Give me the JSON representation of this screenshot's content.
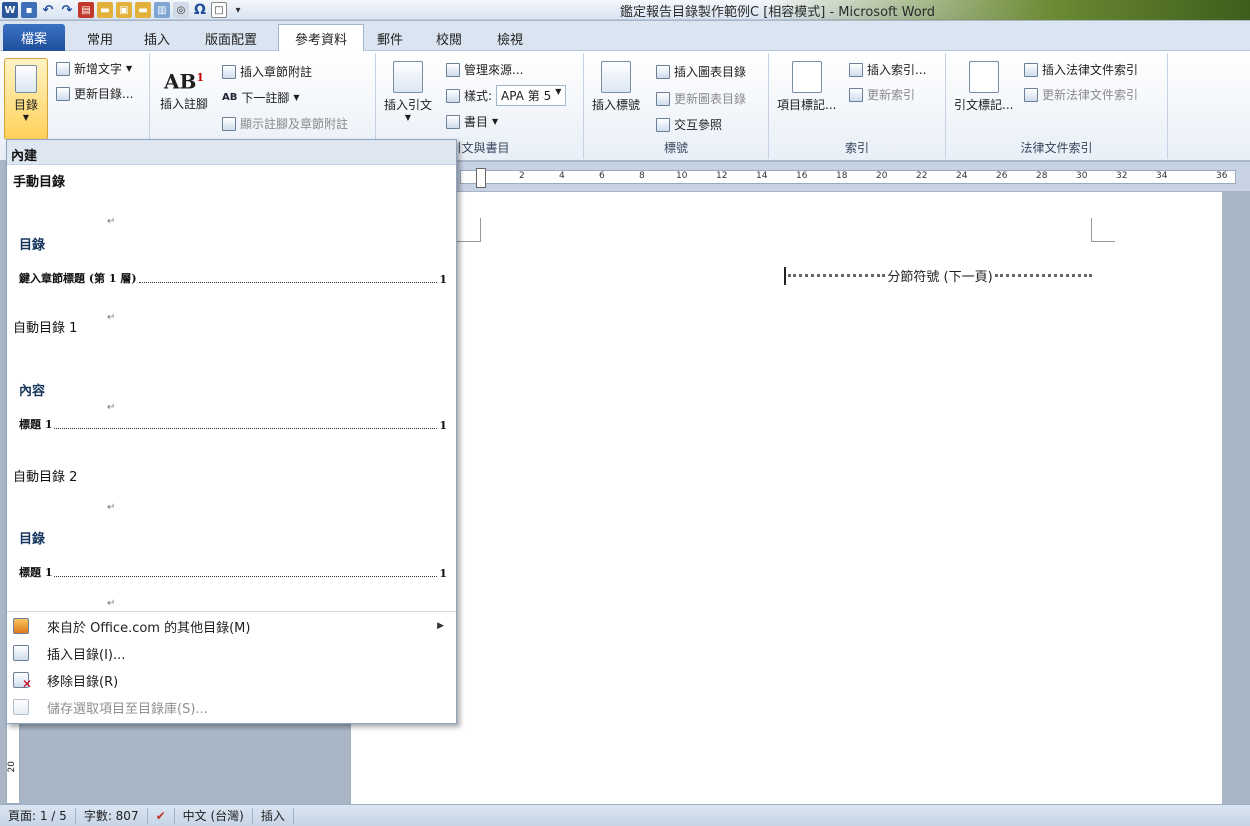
{
  "window": {
    "title": "鑑定報告目錄製作範例C [相容模式] - Microsoft Word"
  },
  "tabs": [
    {
      "label": "檔案"
    },
    {
      "label": "常用"
    },
    {
      "label": "插入"
    },
    {
      "label": "版面配置"
    },
    {
      "label": "參考資料"
    },
    {
      "label": "郵件"
    },
    {
      "label": "校閱"
    },
    {
      "label": "檢視"
    }
  ],
  "ribbon": {
    "toc": {
      "label": "目錄",
      "add_text": "新增文字",
      "update_table": "更新目錄..."
    },
    "footnotes": {
      "insert_footnote": "插入註腳",
      "insert_endnote": "插入章節附註",
      "next_footnote": "下一註腳",
      "show_notes": "顯示註腳及章節附註"
    },
    "citations": {
      "insert_citation": "插入引文",
      "manage_sources": "管理來源...",
      "style_label": "樣式:",
      "style_value": "APA 第 5",
      "bibliography": "書目",
      "group_label": "引文與書目"
    },
    "captions": {
      "insert_caption": "插入標號",
      "insert_table_of_figures": "插入圖表目錄",
      "update_table": "更新圖表目錄",
      "cross_reference": "交互參照",
      "group_label": "標號"
    },
    "index": {
      "mark_entry": "項目標記...",
      "insert_index": "插入索引...",
      "update_index": "更新索引",
      "group_label": "索引"
    },
    "authorities": {
      "mark_citation": "引文標記...",
      "insert_table": "插入法律文件索引",
      "update_table": "更新法律文件索引",
      "group_label": "法律文件索引"
    }
  },
  "ruler": {
    "ticks": [
      "2",
      "4",
      "6",
      "8",
      "10",
      "12",
      "14",
      "16",
      "18",
      "20",
      "22",
      "24",
      "26",
      "28",
      "30",
      "32",
      "34",
      "36"
    ]
  },
  "document": {
    "section_break": "分節符號 (下一頁)"
  },
  "dropdown": {
    "header": "內建",
    "items": [
      {
        "name": "手動目錄",
        "heading": "目錄",
        "entry": "鍵入章節標題 (第 1 層)",
        "page": "1"
      },
      {
        "name": "自動目錄 1",
        "heading": "內容",
        "entry": "標題 1",
        "page": "1"
      },
      {
        "name": "自動目錄 2",
        "heading": "目錄",
        "entry": "標題 1",
        "page": "1"
      }
    ],
    "para_mark": "↵",
    "menu": [
      {
        "label": "來自於 Office.com 的其他目錄(M)",
        "enabled": true
      },
      {
        "label": "插入目錄(I)...",
        "enabled": true
      },
      {
        "label": "移除目錄(R)",
        "enabled": true
      },
      {
        "label": "儲存選取項目至目錄庫(S)...",
        "enabled": false
      }
    ]
  },
  "vruler": {
    "label": "20"
  },
  "statusbar": {
    "page": "頁面: 1 / 5",
    "words": "字數: 807",
    "language": "中文 (台灣)",
    "mode": "插入"
  }
}
